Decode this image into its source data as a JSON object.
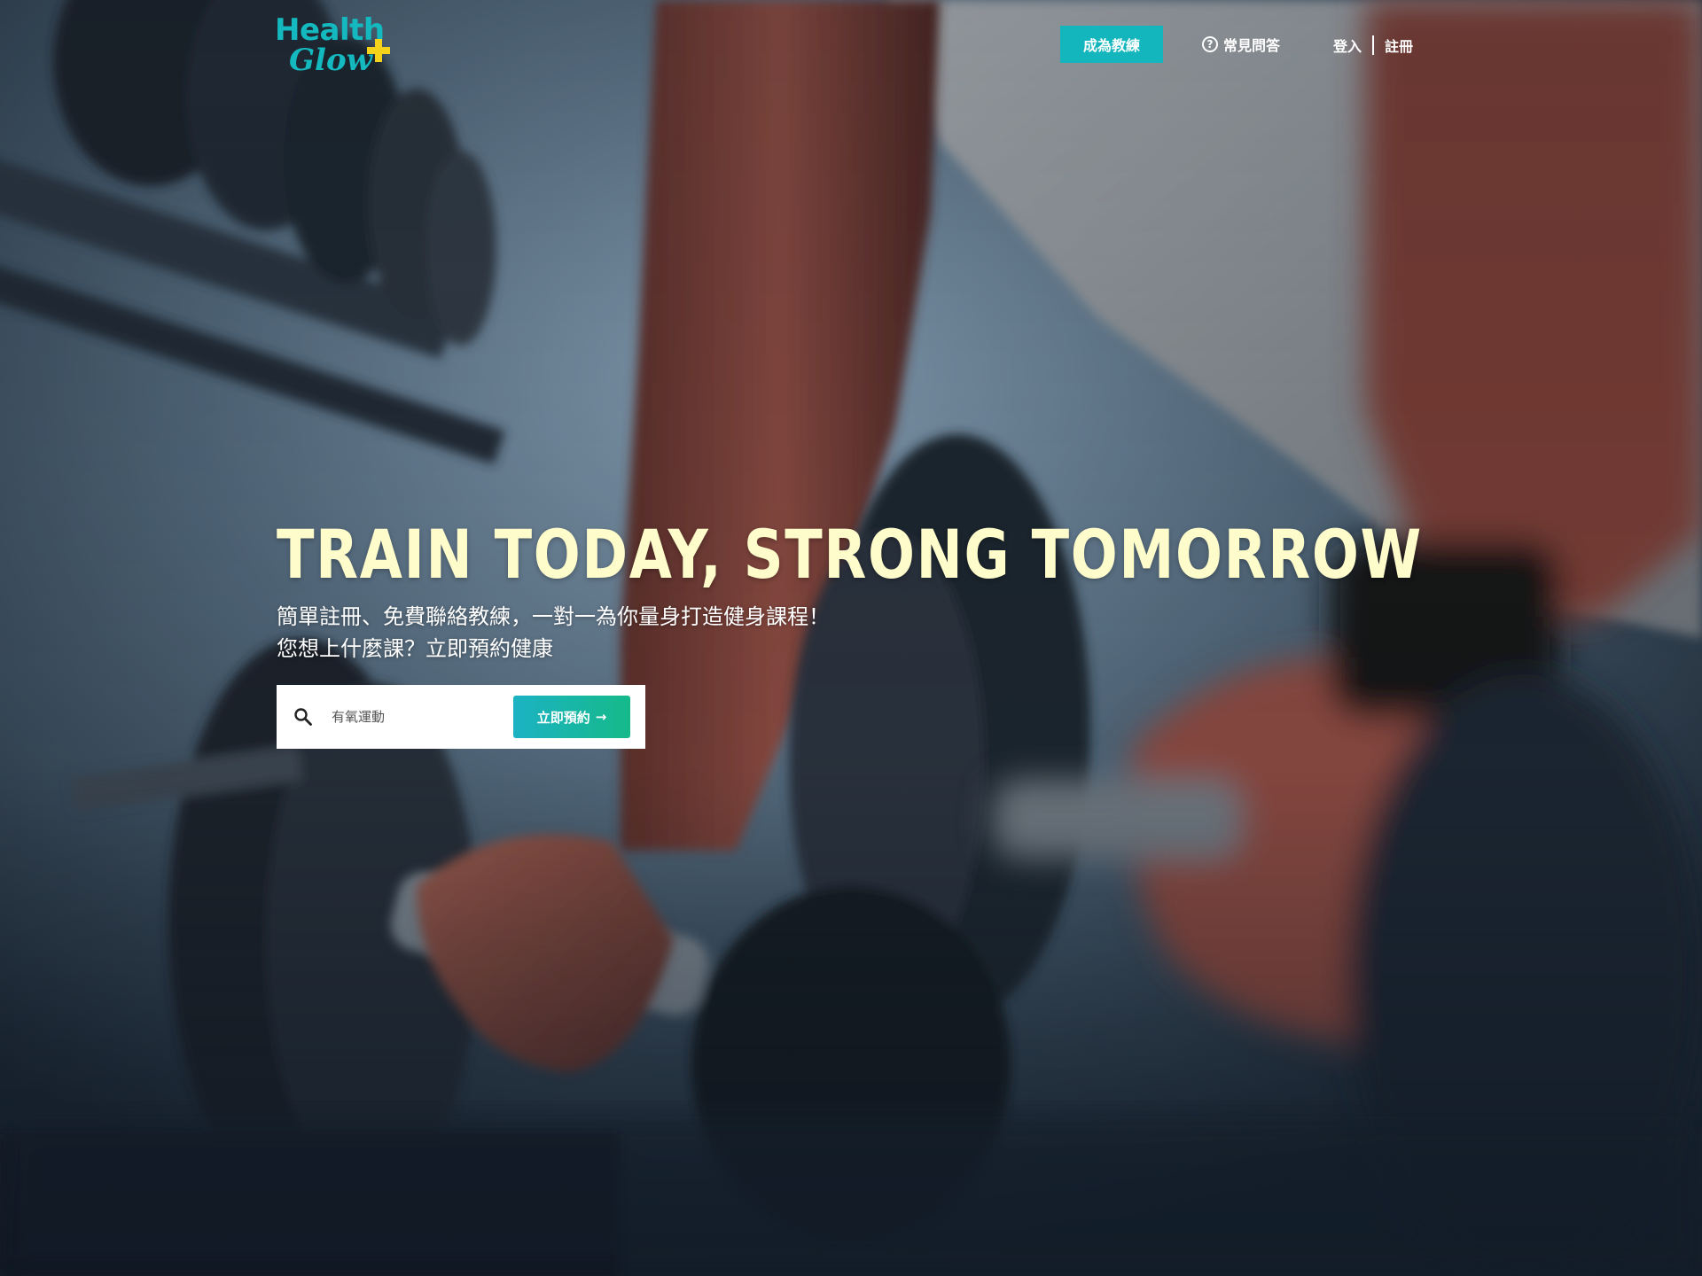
{
  "brand": {
    "logo_line1": "Health",
    "logo_line2": "Glow",
    "primary_color": "#13b6bd",
    "accent_color": "#f4d31a"
  },
  "nav": {
    "become_coach": "成為教練",
    "faq_icon": "help-circle-icon",
    "faq_icon_glyph": "?",
    "faq": "常見問答",
    "login": "登入",
    "register": "註冊"
  },
  "hero": {
    "headline": "TRAIN TODAY, STRONG TOMORROW",
    "headline_color": "#fffccc",
    "subtitle_line1": "簡單註冊、免費聯絡教練，一對一為你量身打造健身課程！",
    "subtitle_line2": "您想上什麼課？立即預約健康"
  },
  "search": {
    "icon": "search-icon",
    "placeholder": "有氧運動",
    "value": "",
    "button_label": "立即預約",
    "button_arrow": "→"
  }
}
